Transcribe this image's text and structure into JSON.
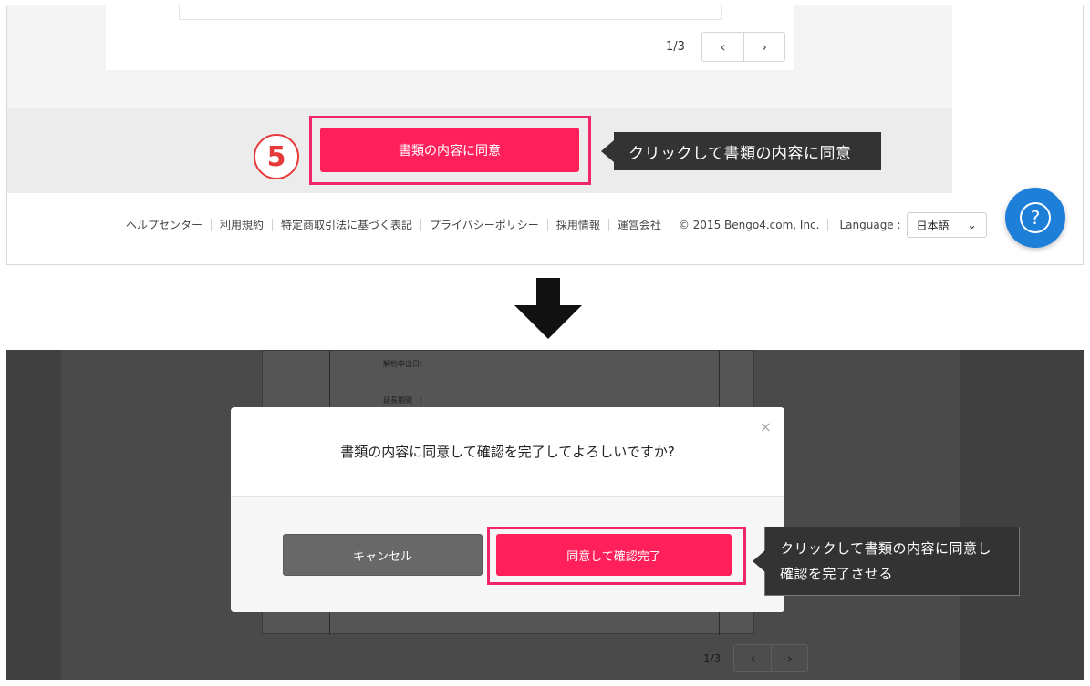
{
  "top": {
    "pager": {
      "page_label": "1/3",
      "prev_glyph": "‹",
      "next_glyph": "›"
    },
    "step_number": "5",
    "agree_button_label": "書類の内容に同意",
    "callout_text": "クリックして書類の内容に同意",
    "footer": {
      "links": [
        "ヘルプセンター",
        "利用規約",
        "特定商取引法に基づく表記",
        "プライバシーポリシー",
        "採用情報",
        "運営会社"
      ],
      "copyright": "© 2015 Bengo4.com, Inc.",
      "language_label": "Language :",
      "language_value": "日本語",
      "language_caret": "⌄"
    },
    "help_glyph": "?"
  },
  "bottom": {
    "bg_doc_lines": [
      "解約申出日：",
      "延長期間　："
    ],
    "pager": {
      "page_label": "1/3",
      "prev_glyph": "‹",
      "next_glyph": "›"
    },
    "modal": {
      "question": "書類の内容に同意して確認を完了してよろしいですか?",
      "close_glyph": "×",
      "cancel_label": "キャンセル",
      "confirm_label": "同意して確認完了"
    },
    "callout_lines": [
      "クリックして書類の内容に同意し",
      "確認を完了させる"
    ]
  },
  "colors": {
    "accent": "#ff1f5a",
    "highlight": "#f0266a",
    "step_circle": "#e63a3a",
    "help_button": "#1e7fd8",
    "callout_bg": "#333333"
  }
}
